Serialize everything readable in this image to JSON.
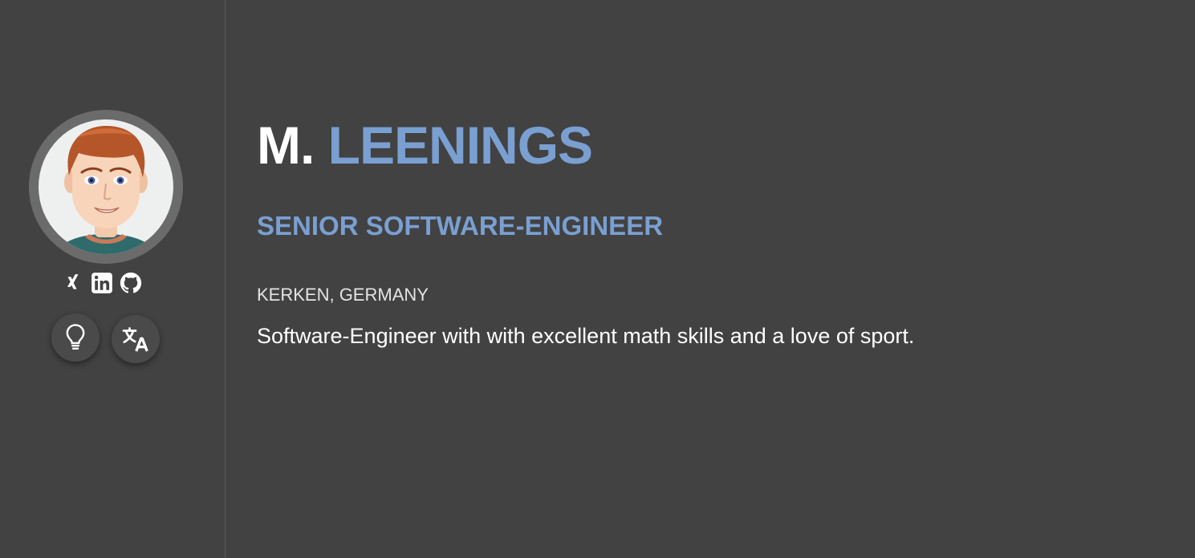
{
  "profile": {
    "first_name": "M.",
    "last_name": "LEENINGS",
    "role": "SENIOR SOFTWARE-ENGINEER",
    "location": "KERKEN, GERMANY",
    "bio": "Software-Engineer with with excellent math skills and a love of sport."
  },
  "sidebar": {
    "social_icons": [
      "xing-icon",
      "linkedin-icon",
      "github-icon"
    ],
    "buttons": [
      "lightbulb-icon",
      "translate-icon"
    ]
  },
  "colors": {
    "background": "#424242",
    "accent": "#7a9fd1",
    "text": "#ffffff"
  }
}
